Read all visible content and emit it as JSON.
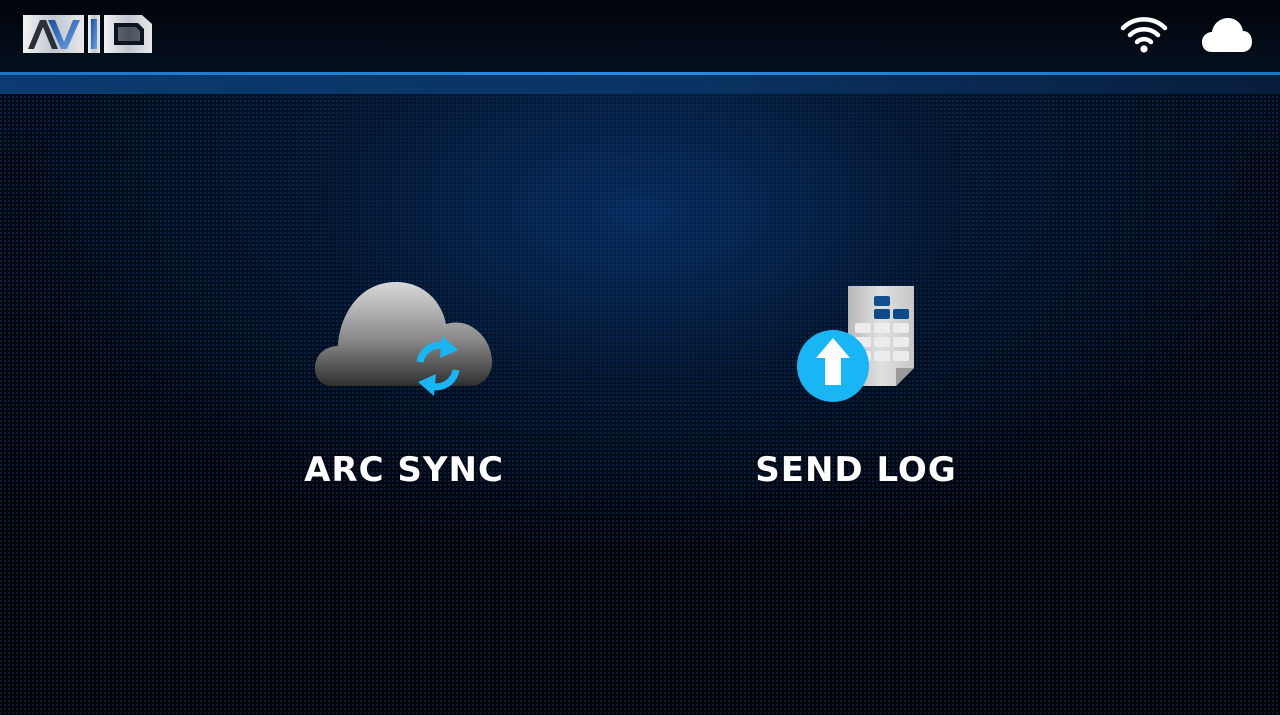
{
  "header": {
    "logo_text": "AVID",
    "status_icons": [
      "wifi-icon",
      "cloud-icon"
    ]
  },
  "main": {
    "tiles": [
      {
        "label": "ARC SYNC",
        "icon": "cloud-sync-icon"
      },
      {
        "label": "SEND LOG",
        "icon": "log-upload-icon"
      }
    ]
  },
  "colors": {
    "accent": "#19b6f5",
    "header_line": "#2b8ae0",
    "label": "#ffffff"
  }
}
